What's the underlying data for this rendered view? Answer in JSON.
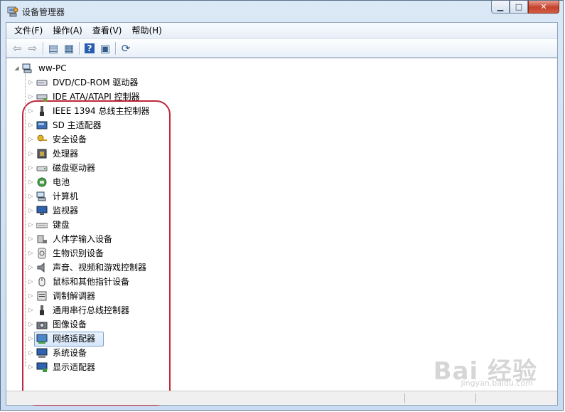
{
  "window": {
    "title": "设备管理器",
    "buttons": {
      "minimize": "▁",
      "maximize": "□",
      "close": "✕"
    }
  },
  "menu": [
    "文件(F)",
    "操作(A)",
    "查看(V)",
    "帮助(H)"
  ],
  "toolbar": [
    {
      "name": "back-icon",
      "glyph": "⇦"
    },
    {
      "name": "forward-icon",
      "glyph": "⇨"
    },
    {
      "name": "show-hide-tree-icon",
      "glyph": "▤"
    },
    {
      "name": "properties-icon",
      "glyph": "▦"
    },
    {
      "name": "help-icon",
      "glyph": "?"
    },
    {
      "name": "view-icon",
      "glyph": "▣"
    },
    {
      "name": "scan-hardware-icon",
      "glyph": "⟳"
    }
  ],
  "tree": {
    "root": {
      "label": "ww-PC",
      "icon": "computer-icon"
    },
    "categories": [
      {
        "label": "DVD/CD-ROM 驱动器",
        "icon": "dvd-drive-icon"
      },
      {
        "label": "IDE ATA/ATAPI 控制器",
        "icon": "ide-controller-icon"
      },
      {
        "label": "IEEE 1394 总线主控制器",
        "icon": "ieee1394-icon"
      },
      {
        "label": "SD 主适配器",
        "icon": "sd-adapter-icon"
      },
      {
        "label": "安全设备",
        "icon": "security-key-icon"
      },
      {
        "label": "处理器",
        "icon": "processor-icon"
      },
      {
        "label": "磁盘驱动器",
        "icon": "disk-drive-icon"
      },
      {
        "label": "电池",
        "icon": "battery-icon"
      },
      {
        "label": "计算机",
        "icon": "computer-icon"
      },
      {
        "label": "监视器",
        "icon": "monitor-icon"
      },
      {
        "label": "键盘",
        "icon": "keyboard-icon"
      },
      {
        "label": "人体学输入设备",
        "icon": "hid-icon"
      },
      {
        "label": "生物识别设备",
        "icon": "fingerprint-icon"
      },
      {
        "label": "声音、视频和游戏控制器",
        "icon": "speaker-icon"
      },
      {
        "label": "鼠标和其他指针设备",
        "icon": "mouse-icon"
      },
      {
        "label": "调制解调器",
        "icon": "modem-icon"
      },
      {
        "label": "通用串行总线控制器",
        "icon": "usb-icon"
      },
      {
        "label": "图像设备",
        "icon": "camera-icon"
      },
      {
        "label": "网络适配器",
        "icon": "network-adapter-icon",
        "selected": true
      },
      {
        "label": "系统设备",
        "icon": "system-device-icon"
      },
      {
        "label": "显示适配器",
        "icon": "display-adapter-icon"
      }
    ]
  },
  "colors": {
    "highlight_border": "#c0273a",
    "selection": "#d5e6fa"
  },
  "watermark": {
    "main": "Bai 经验",
    "sub": "jingyan.baidu.com"
  }
}
